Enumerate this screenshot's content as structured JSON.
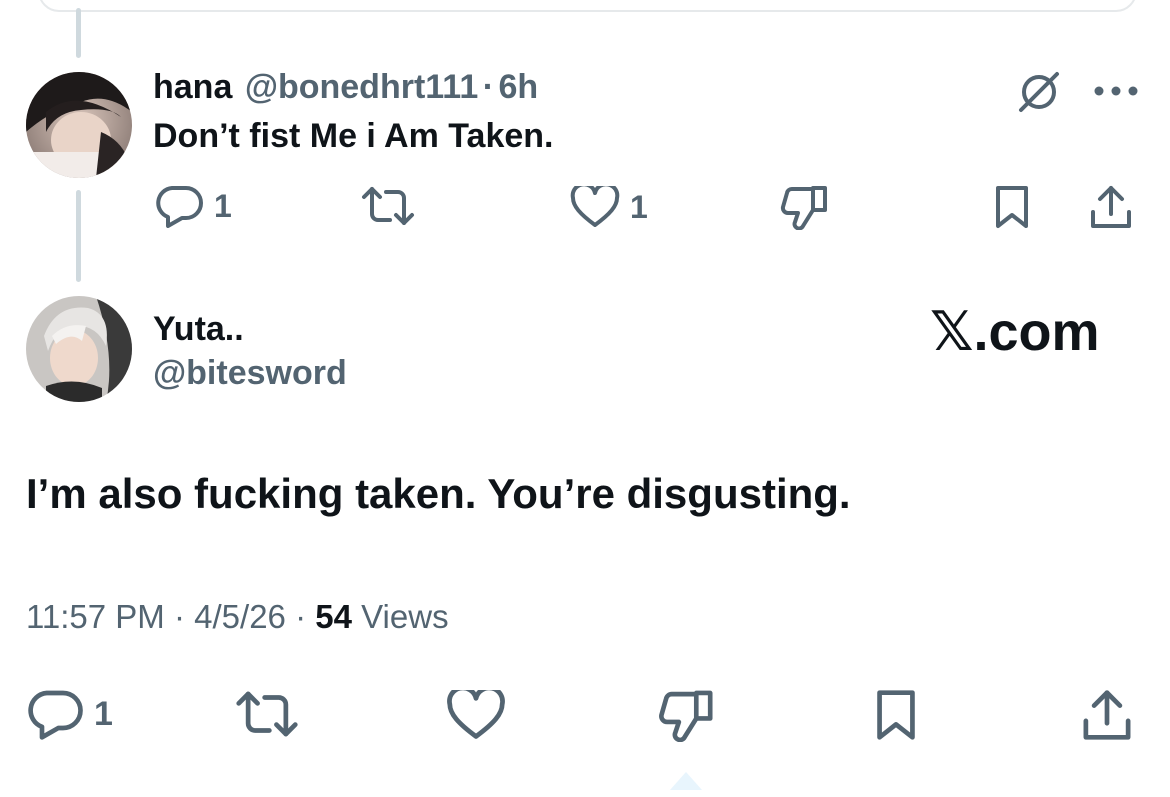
{
  "reply_tweet": {
    "author_name": "hana",
    "author_handle": "@bonedhrt111",
    "separator": "·",
    "time_ago": "6h",
    "text": "Don’t fist Me i Am Taken.",
    "reply_count": "1",
    "like_count": "1",
    "icons": [
      "grok-icon",
      "more-icon",
      "reply-icon",
      "retweet-icon",
      "like-icon",
      "dislike-icon",
      "bookmark-icon",
      "share-icon"
    ]
  },
  "main_tweet": {
    "author_name": "Yuta..",
    "author_handle": "@bitesword",
    "watermark": "𝕏.com",
    "text": "I’m also fucking taken. You’re disgusting.",
    "time": "11:57 PM",
    "separator1": "·",
    "date": "4/5/26",
    "separator2": "·",
    "views_count": "54",
    "views_label": "Views",
    "reply_count": "1",
    "icons": [
      "reply-icon",
      "retweet-icon",
      "like-icon",
      "dislike-icon",
      "bookmark-icon",
      "share-icon"
    ]
  },
  "colors": {
    "text_primary": "#0f1419",
    "text_secondary": "#536471",
    "thread_line": "#cfd9de",
    "accent": "#1d9bf0"
  }
}
